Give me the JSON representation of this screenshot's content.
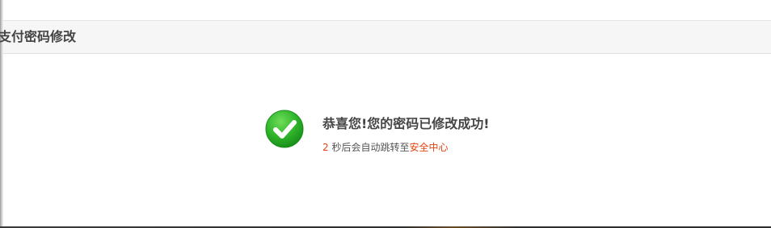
{
  "panel": {
    "title": "支付密码修改"
  },
  "result": {
    "icon": "check-circle-icon",
    "message": "恭喜您!您的密码已修改成功!",
    "countdown": "2",
    "redirect_text": " 秒后会自动跳转至",
    "link_label": "安全中心"
  },
  "colors": {
    "accent": "#e6430f",
    "success_green": "#2fb52a",
    "header_bg": "#f6f6f6"
  }
}
